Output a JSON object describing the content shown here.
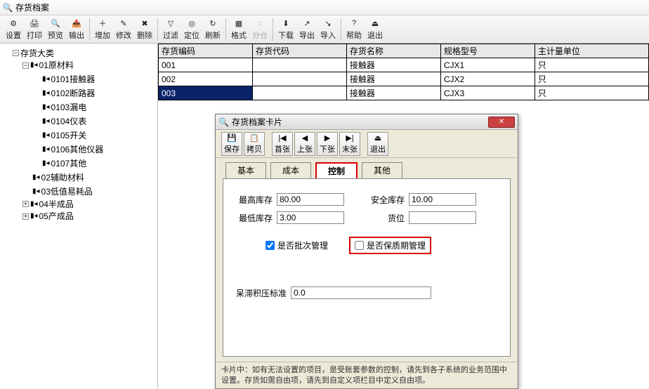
{
  "window": {
    "title": "存货档案"
  },
  "toolbar": [
    {
      "id": "settings",
      "label": "设置",
      "icon": "⚙"
    },
    {
      "id": "print",
      "label": "打印",
      "icon": "🖨"
    },
    {
      "id": "preview",
      "label": "预览",
      "icon": "🔍"
    },
    {
      "id": "output",
      "label": "输出",
      "icon": "📤"
    },
    {
      "sep": true
    },
    {
      "id": "add",
      "label": "增加",
      "icon": "＋"
    },
    {
      "id": "edit",
      "label": "修改",
      "icon": "✎"
    },
    {
      "id": "delete",
      "label": "删除",
      "icon": "✖"
    },
    {
      "sep": true
    },
    {
      "id": "filter",
      "label": "过滤",
      "icon": "▽"
    },
    {
      "id": "locate",
      "label": "定位",
      "icon": "◎"
    },
    {
      "id": "refresh",
      "label": "刷新",
      "icon": "↻"
    },
    {
      "sep": true
    },
    {
      "id": "format",
      "label": "格式",
      "icon": "▦"
    },
    {
      "id": "split",
      "label": "分仓",
      "icon": "⌂",
      "disabled": true
    },
    {
      "sep": true
    },
    {
      "id": "download",
      "label": "下载",
      "icon": "⬇"
    },
    {
      "id": "export",
      "label": "导出",
      "icon": "↗"
    },
    {
      "id": "import",
      "label": "导入",
      "icon": "↘"
    },
    {
      "sep": true
    },
    {
      "id": "help",
      "label": "帮助",
      "icon": "?"
    },
    {
      "id": "exit",
      "label": "退出",
      "icon": "⏏"
    }
  ],
  "tree": {
    "root": {
      "label": "存货大类",
      "expanded": true
    },
    "items": [
      {
        "code": "01",
        "label": "01原材料",
        "expanded": true,
        "children": [
          {
            "label": "0101接触器"
          },
          {
            "label": "0102断路器"
          },
          {
            "label": "0103漏电"
          },
          {
            "label": "0104仪表"
          },
          {
            "label": "0105开关"
          },
          {
            "label": "0106其他仪器"
          },
          {
            "label": "0107其他"
          }
        ]
      },
      {
        "code": "02",
        "label": "02辅助材料",
        "expanded": false,
        "leaf": true
      },
      {
        "code": "03",
        "label": "03低值易耗品",
        "expanded": false,
        "leaf": true
      },
      {
        "code": "04",
        "label": "04半成品",
        "expanded": false
      },
      {
        "code": "05",
        "label": "05产成品",
        "expanded": false
      }
    ]
  },
  "grid": {
    "columns": [
      "存货编码",
      "存货代码",
      "存货名称",
      "规格型号",
      "主计量单位"
    ],
    "rows": [
      {
        "code": "001",
        "alias": "",
        "name": "接触器",
        "spec": "CJX1",
        "unit": "只"
      },
      {
        "code": "002",
        "alias": "",
        "name": "接触器",
        "spec": "CJX2",
        "unit": "只"
      },
      {
        "code": "003",
        "alias": "",
        "name": "接触器",
        "spec": "CJX3",
        "unit": "只",
        "selected": true
      }
    ]
  },
  "dialog": {
    "title": "存货档案卡片",
    "toolbar": [
      {
        "id": "save",
        "label": "保存",
        "icon": "💾"
      },
      {
        "id": "copy",
        "label": "拷贝",
        "icon": "📋"
      },
      {
        "sep": true
      },
      {
        "id": "first",
        "label": "首张",
        "icon": "|◀"
      },
      {
        "id": "prev",
        "label": "上张",
        "icon": "◀"
      },
      {
        "id": "next",
        "label": "下张",
        "icon": "▶"
      },
      {
        "id": "last",
        "label": "末张",
        "icon": "▶|"
      },
      {
        "sep": true
      },
      {
        "id": "exit",
        "label": "退出",
        "icon": "⏏"
      }
    ],
    "tabs": [
      "基本",
      "成本",
      "控制",
      "其他"
    ],
    "active_tab": "控制",
    "form": {
      "max_stock_label": "最高库存",
      "max_stock": "80.00",
      "safe_stock_label": "安全库存",
      "safe_stock": "10.00",
      "min_stock_label": "最低库存",
      "min_stock": "3.00",
      "bin_label": "货位",
      "bin": "",
      "batch_label": "是否批次管理",
      "batch_checked": true,
      "shelf_label": "是否保质期管理",
      "shelf_checked": false,
      "stagnant_label": "呆滞积压标准",
      "stagnant": "0.0"
    },
    "footer": "卡片中：如有无法设置的项目，是受账套参数的控制，请先到各子系统的业务范围中设置。存货如需自由项，请先到自定义项栏目中定义自由项。"
  }
}
